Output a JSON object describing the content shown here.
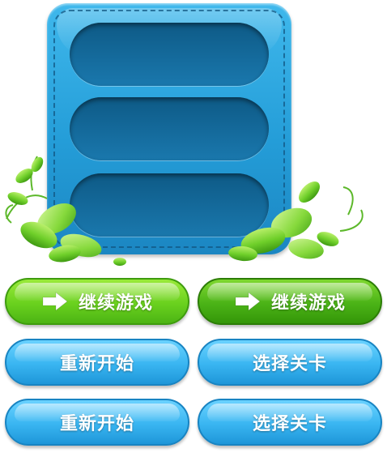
{
  "buttons": {
    "continue_1": {
      "label": "继续游戏",
      "icon": "arrow-right-icon"
    },
    "continue_2": {
      "label": "继续游戏",
      "icon": "arrow-right-icon"
    },
    "restart_1": {
      "label": "重新开始"
    },
    "select_level_1": {
      "label": "选择关卡"
    },
    "restart_2": {
      "label": "重新开始"
    },
    "select_level_2": {
      "label": "选择关卡"
    }
  },
  "colors": {
    "panel": "#249dd8",
    "slot": "#156c9e",
    "button_green": "#6ad11e",
    "button_green_dark": "#4bb317",
    "button_blue": "#39b5f1",
    "leaf": "#6fcf2a"
  }
}
